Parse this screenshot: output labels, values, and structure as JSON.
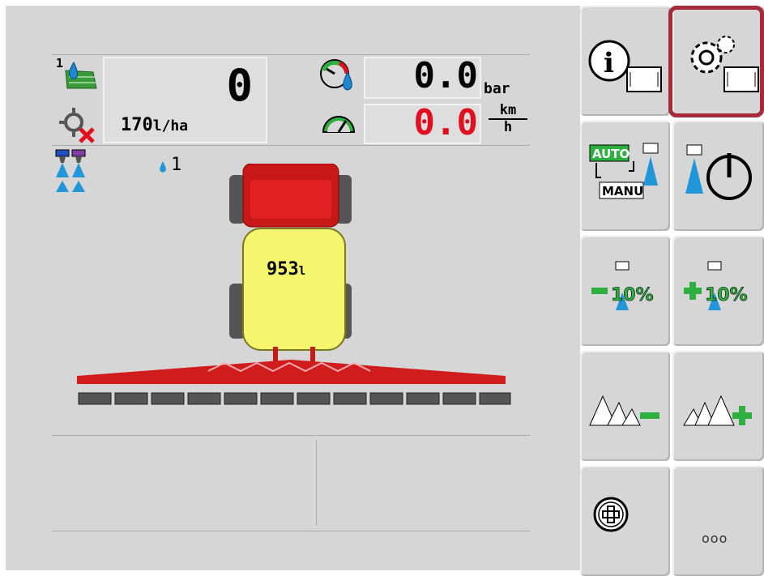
{
  "work_panel": {
    "applied_volume": "0",
    "target_rate": "170",
    "target_rate_unit": "l/ha",
    "field_counter": "1",
    "section_count": "1"
  },
  "pressure": {
    "value": "0.0",
    "unit": "bar"
  },
  "speed": {
    "value": "0.0",
    "unit_top": "km",
    "unit_bottom": "h",
    "value_color": "#e01020"
  },
  "tank": {
    "level": "953",
    "unit": "l"
  },
  "softkeys": {
    "info": "info-icon",
    "settings": "settings-icon",
    "auto_manu": {
      "auto": "AUTO",
      "manu": "MANU"
    },
    "minus_pct": "10%",
    "plus_pct": "10%",
    "more": "ooo"
  },
  "colors": {
    "highlight": "#a52a3a",
    "boom": "#d01c1c",
    "tank": "#f5f56e",
    "water": "#2196d8"
  }
}
